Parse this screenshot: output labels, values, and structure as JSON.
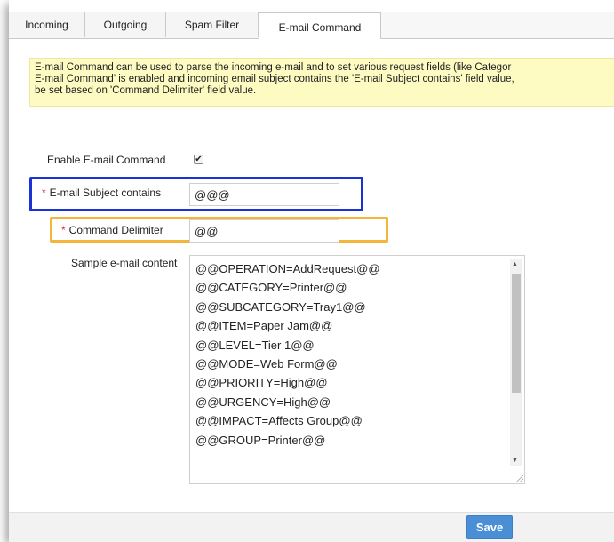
{
  "tabs": [
    {
      "label": "Incoming"
    },
    {
      "label": "Outgoing"
    },
    {
      "label": "Spam Filter"
    },
    {
      "label": "E-mail Command",
      "active": true
    }
  ],
  "info_text": "E-mail Command can be used to parse the incoming e-mail and to set various request fields (like Categor\nE-mail Command' is enabled and incoming email subject contains the 'E-mail Subject contains' field value,\nbe set based on 'Command Delimiter' field value.",
  "form": {
    "enable_label": "Enable E-mail Command",
    "enable_checked": true,
    "subject_label": "E-mail Subject contains",
    "subject_value": "@@@",
    "delimiter_label": "Command Delimiter",
    "delimiter_value": "@@",
    "sample_label": "Sample e-mail content",
    "sample_lines": [
      "@@OPERATION=AddRequest@@",
      "@@CATEGORY=Printer@@",
      "@@SUBCATEGORY=Tray1@@",
      "@@ITEM=Paper Jam@@",
      "@@LEVEL=Tier 1@@",
      "@@MODE=Web Form@@",
      "@@PRIORITY=High@@",
      "@@URGENCY=High@@",
      "@@IMPACT=Affects Group@@",
      "@@GROUP=Printer@@"
    ]
  },
  "save_label": "Save",
  "colors": {
    "info_bg": "#fdfbc2",
    "highlight_blue": "#1a33d6",
    "highlight_orange": "#f5b43a",
    "save_button": "#4a8fd6",
    "required": "#e03030"
  }
}
